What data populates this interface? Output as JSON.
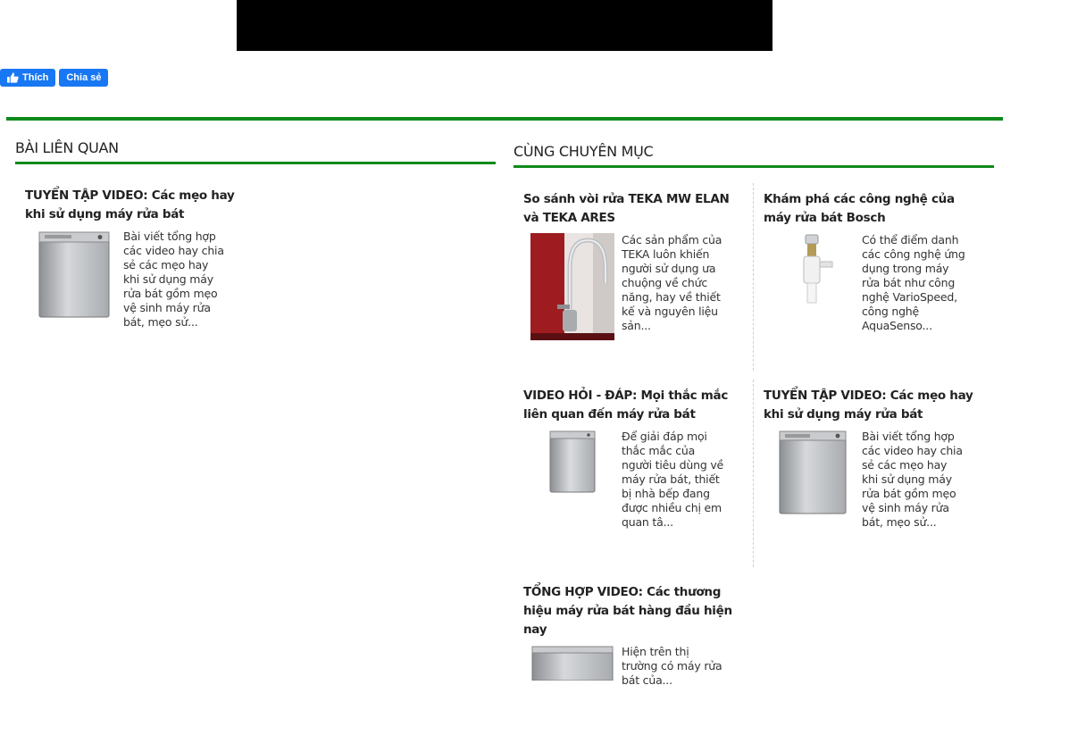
{
  "facebook": {
    "like_label": "Thích",
    "share_label": "Chia sẻ",
    "color": "#1877f2"
  },
  "accent_color": "#0f8a1a",
  "related": {
    "heading": "BÀI LIÊN QUAN",
    "items": [
      {
        "title": "TUYỂN TẬP VIDEO: Các mẹo hay khi sử dụng máy rửa bát",
        "excerpt": "Bài viết tổng hợp các video hay chia sẻ các mẹo hay khi sử dụng máy rửa bát gồm mẹo vệ sinh máy rửa bát, mẹo sử...",
        "image": "dishwasher-image"
      }
    ]
  },
  "same_category": {
    "heading": "CÙNG CHUYÊN MỤC",
    "items": [
      {
        "title": "So sánh vòi rửa TEKA MW ELAN và TEKA ARES",
        "excerpt": "Các sản phẩm của TEKA luôn khiến người sử dụng ưa chuộng về chức năng, hay về thiết kế và nguyên liệu sản...",
        "image": "faucet-image"
      },
      {
        "title": "Khám phá các công nghệ của máy rửa bát Bosch",
        "excerpt": "Có thể điểm danh các công nghệ ứng dụng trong máy rửa bát như công nghệ VarioSpeed, công nghệ AquaSenso...",
        "image": "valve-image"
      },
      {
        "title": "VIDEO HỎI - ĐÁP: Mọi thắc mắc liên quan đến máy rửa bát",
        "excerpt": "Để giải đáp mọi thắc mắc của người tiêu dùng về máy rửa bát, thiết bị nhà bếp đang được nhiều chị em quan tâ...",
        "image": "dishwasher-image"
      },
      {
        "title": "TUYỂN TẬP VIDEO: Các mẹo hay khi sử dụng máy rửa bát",
        "excerpt": "Bài viết tổng hợp các video hay chia sẻ các mẹo hay khi sử dụng máy rửa bát gồm mẹo vệ sinh máy rửa bát, mẹo sử...",
        "image": "dishwasher-image"
      },
      {
        "title": "TỔNG HỢP VIDEO: Các thương hiệu máy rửa bát hàng đầu hiện nay",
        "excerpt": "Hiện trên thị trường có máy rửa bát của...",
        "image": "dishwasher-image"
      }
    ]
  }
}
